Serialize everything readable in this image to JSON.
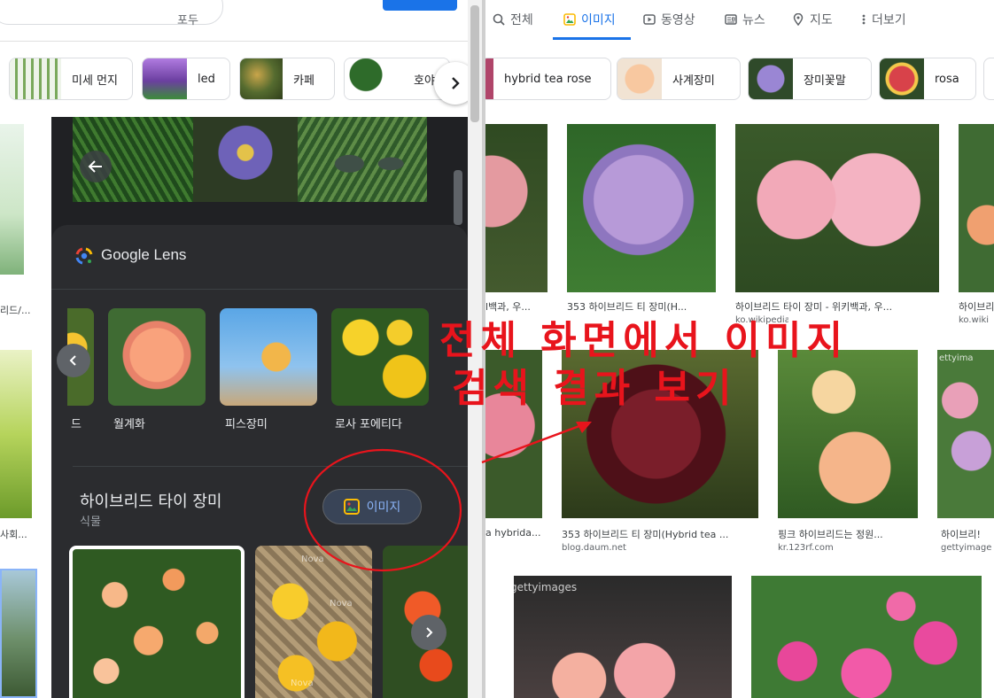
{
  "left": {
    "top_input_text": "포두",
    "chips": [
      {
        "label": "미세 먼지",
        "icon": "leaf-chart-thumbnail"
      },
      {
        "label": "led",
        "icon": "purple-grow-light-thumbnail"
      },
      {
        "label": "카페",
        "icon": "plant-cafe-thumbnail"
      },
      {
        "label": "호야",
        "icon": "potted-plant-thumbnail"
      }
    ],
    "left_edge_labels": [
      "리드/...",
      "사회..."
    ],
    "lens": {
      "title": "Google Lens",
      "similar": [
        {
          "label": "드"
        },
        {
          "label": "월계화"
        },
        {
          "label": "피스장미"
        },
        {
          "label": "로사 포에티다"
        }
      ],
      "entity_title": "하이브리드 타이 장미",
      "entity_subtitle": "식물",
      "images_button_label": "이미지",
      "photo_watermarks": [
        "Nova",
        "Nova",
        "Nova"
      ]
    }
  },
  "right": {
    "tabs": [
      {
        "label": "전체",
        "icon": "search-icon"
      },
      {
        "label": "이미지",
        "icon": "image-icon",
        "active": true
      },
      {
        "label": "동영상",
        "icon": "video-icon"
      },
      {
        "label": "뉴스",
        "icon": "news-icon"
      },
      {
        "label": "지도",
        "icon": "map-pin-icon"
      },
      {
        "label": "더보기",
        "icon": "more-icon"
      }
    ],
    "chips": [
      {
        "label": "hybrid tea rose"
      },
      {
        "label": "사계장미"
      },
      {
        "label": "장미꽃말"
      },
      {
        "label": "rosa"
      }
    ],
    "results_row1": [
      {
        "caption": "l백과, 우...",
        "source": ""
      },
      {
        "caption": "353 하이브리드 티 장미(H...",
        "source": ""
      },
      {
        "caption": "하이브리드 타이 장미 - 위키백과, 우...",
        "source": "ko.wikipedia.org"
      },
      {
        "caption": "하이브리",
        "source": "ko.wiki"
      }
    ],
    "results_row2": [
      {
        "caption": "a hybrida...",
        "source": ""
      },
      {
        "caption": "353 하이브리드 티 장미(Hybrid tea ...",
        "source": "blog.daum.net"
      },
      {
        "caption": "핑크 하이브리드는 정원...",
        "source": "kr.123rf.com"
      },
      {
        "caption": "하이브리!",
        "source": "gettyimage"
      }
    ],
    "watermark_getty": "gettyimages",
    "watermark_getty2": "ettyima"
  },
  "annotation": {
    "line1": "전체 화면에서 이미지",
    "line2": "검색 결과 보기",
    "color": "#e8141c"
  }
}
